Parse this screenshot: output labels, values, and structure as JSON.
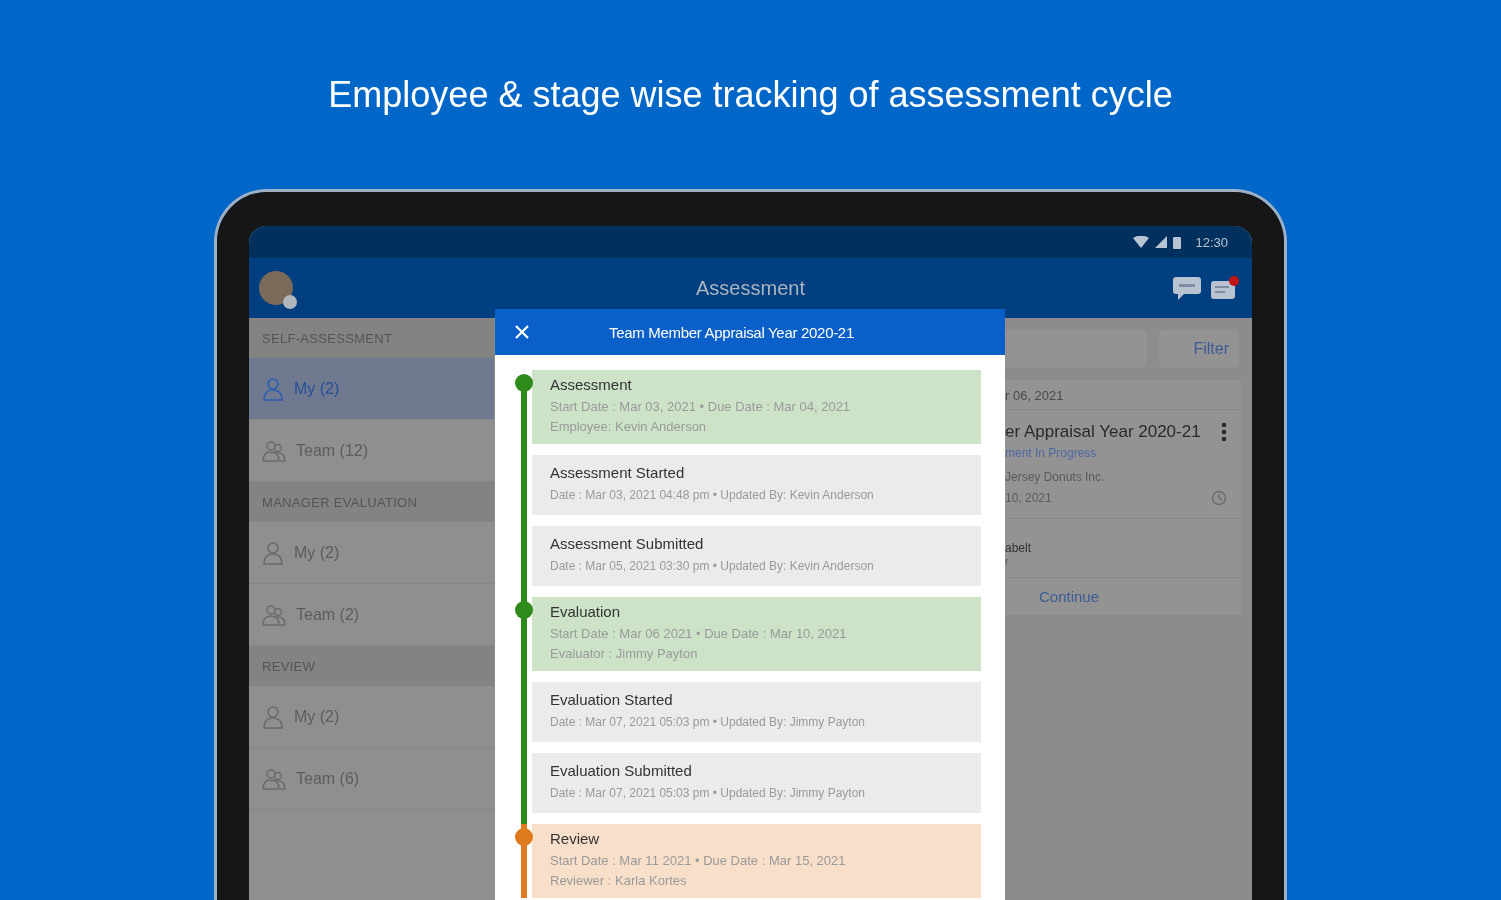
{
  "headline": "Employee & stage wise tracking of assessment cycle",
  "status_bar": {
    "time": "12:30"
  },
  "app_bar": {
    "title": "Assessment"
  },
  "sidebar": {
    "sections": [
      {
        "title": "SELF-ASSESSMENT",
        "items": [
          {
            "label": "My (2)",
            "kind": "person",
            "selected": true
          },
          {
            "label": "Team (12)",
            "kind": "team",
            "selected": false
          }
        ]
      },
      {
        "title": "MANAGER EVALUATION",
        "items": [
          {
            "label": "My (2)",
            "kind": "person",
            "selected": false
          },
          {
            "label": "Team (2)",
            "kind": "team",
            "selected": false
          }
        ]
      },
      {
        "title": "REVIEW",
        "items": [
          {
            "label": "My (2)",
            "kind": "person",
            "selected": false
          },
          {
            "label": "Team (6)",
            "kind": "team",
            "selected": false
          }
        ]
      }
    ]
  },
  "main": {
    "filter_button": "Filter",
    "card": {
      "date": "r 06, 2021",
      "title": "er Appraisal Year 2020-21",
      "status": "ment In Progress",
      "company": "Jersey Donuts Inc.",
      "due": "10, 2021",
      "person": "abelt",
      "role": "r",
      "action": "Continue"
    }
  },
  "dialog": {
    "title": "Team Member Appraisal Year 2020-21",
    "timeline": [
      {
        "kind": "stage",
        "title": "Assessment",
        "color": "#2e8b1a",
        "lines": [
          "Start Date : Mar 03, 2021 • Due Date : Mar 04, 2021",
          "Employee: Kevin Anderson"
        ]
      },
      {
        "kind": "event",
        "title": "Assessment Started",
        "lines": [
          "Date : Mar 03, 2021 04:48 pm • Updated By: Kevin Anderson"
        ]
      },
      {
        "kind": "event",
        "title": "Assessment Submitted",
        "lines": [
          "Date : Mar 05, 2021 03:30 pm • Updated By: Kevin Anderson"
        ]
      },
      {
        "kind": "stage",
        "title": "Evaluation",
        "color": "#2e8b1a",
        "lines": [
          "Start Date : Mar 06 2021 • Due Date : Mar 10, 2021",
          "Evaluator : Jimmy Payton"
        ]
      },
      {
        "kind": "event",
        "title": "Evaluation Started",
        "lines": [
          "Date : Mar 07, 2021 05:03 pm • Updated By: Jimmy Payton"
        ]
      },
      {
        "kind": "event",
        "title": "Evaluation Submitted",
        "lines": [
          "Date : Mar 07, 2021 05:03 pm • Updated By: Jimmy Payton"
        ]
      },
      {
        "kind": "stage",
        "title": "Review",
        "color": "#e07a1f",
        "lines": [
          "Start Date : Mar 11 2021 • Due Date : Mar 15, 2021",
          "Reviewer : Karla Kortes"
        ]
      }
    ]
  }
}
